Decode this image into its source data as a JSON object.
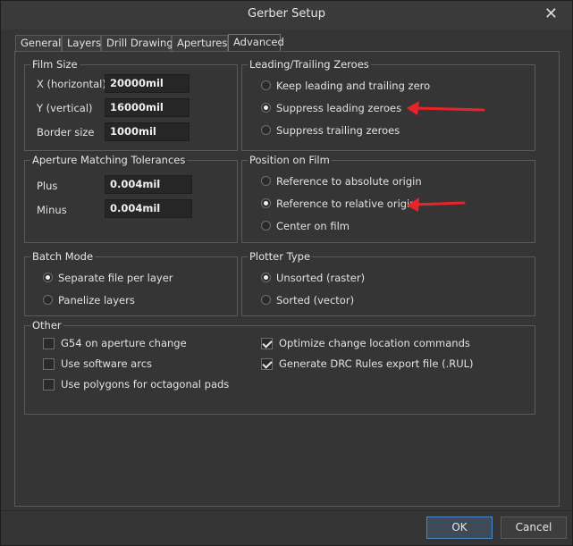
{
  "window": {
    "title": "Gerber Setup",
    "close_glyph": "✕"
  },
  "tabs": [
    {
      "label": "General"
    },
    {
      "label": "Layers"
    },
    {
      "label": "Drill Drawing"
    },
    {
      "label": "Apertures"
    },
    {
      "label": "Advanced"
    }
  ],
  "active_tab": "Advanced",
  "film_size": {
    "title": "Film Size",
    "x_label": "X (horizontal)",
    "x_value": "20000mil",
    "y_label": "Y (vertical)",
    "y_value": "16000mil",
    "border_label": "Border size",
    "border_value": "1000mil"
  },
  "aperture_tolerances": {
    "title": "Aperture Matching Tolerances",
    "plus_label": "Plus",
    "plus_value": "0.004mil",
    "minus_label": "Minus",
    "minus_value": "0.004mil"
  },
  "batch_mode": {
    "title": "Batch Mode",
    "options": [
      {
        "label": "Separate file per layer",
        "selected": true
      },
      {
        "label": "Panelize layers",
        "selected": false
      }
    ]
  },
  "leading_trailing": {
    "title": "Leading/Trailing Zeroes",
    "options": [
      {
        "label": "Keep leading and trailing zero",
        "selected": false
      },
      {
        "label": "Suppress leading zeroes",
        "selected": true
      },
      {
        "label": "Suppress trailing zeroes",
        "selected": false
      }
    ]
  },
  "position_on_film": {
    "title": "Position on Film",
    "options": [
      {
        "label": "Reference to absolute origin",
        "selected": false
      },
      {
        "label": "Reference to relative origin",
        "selected": true
      },
      {
        "label": "Center on film",
        "selected": false
      }
    ]
  },
  "plotter_type": {
    "title": "Plotter Type",
    "options": [
      {
        "label": "Unsorted (raster)",
        "selected": true
      },
      {
        "label": "Sorted (vector)",
        "selected": false
      }
    ]
  },
  "other": {
    "title": "Other",
    "checks": [
      {
        "label": "G54 on aperture change",
        "checked": false
      },
      {
        "label": "Use software arcs",
        "checked": false
      },
      {
        "label": "Use polygons for octagonal pads",
        "checked": false
      },
      {
        "label": "Optimize change location commands",
        "checked": true
      },
      {
        "label": "Generate DRC Rules export file (.RUL)",
        "checked": true
      }
    ]
  },
  "buttons": {
    "ok": "OK",
    "cancel": "Cancel"
  },
  "colors": {
    "annotation_arrow": "#e8242a",
    "ok_border": "#4a88c8"
  }
}
